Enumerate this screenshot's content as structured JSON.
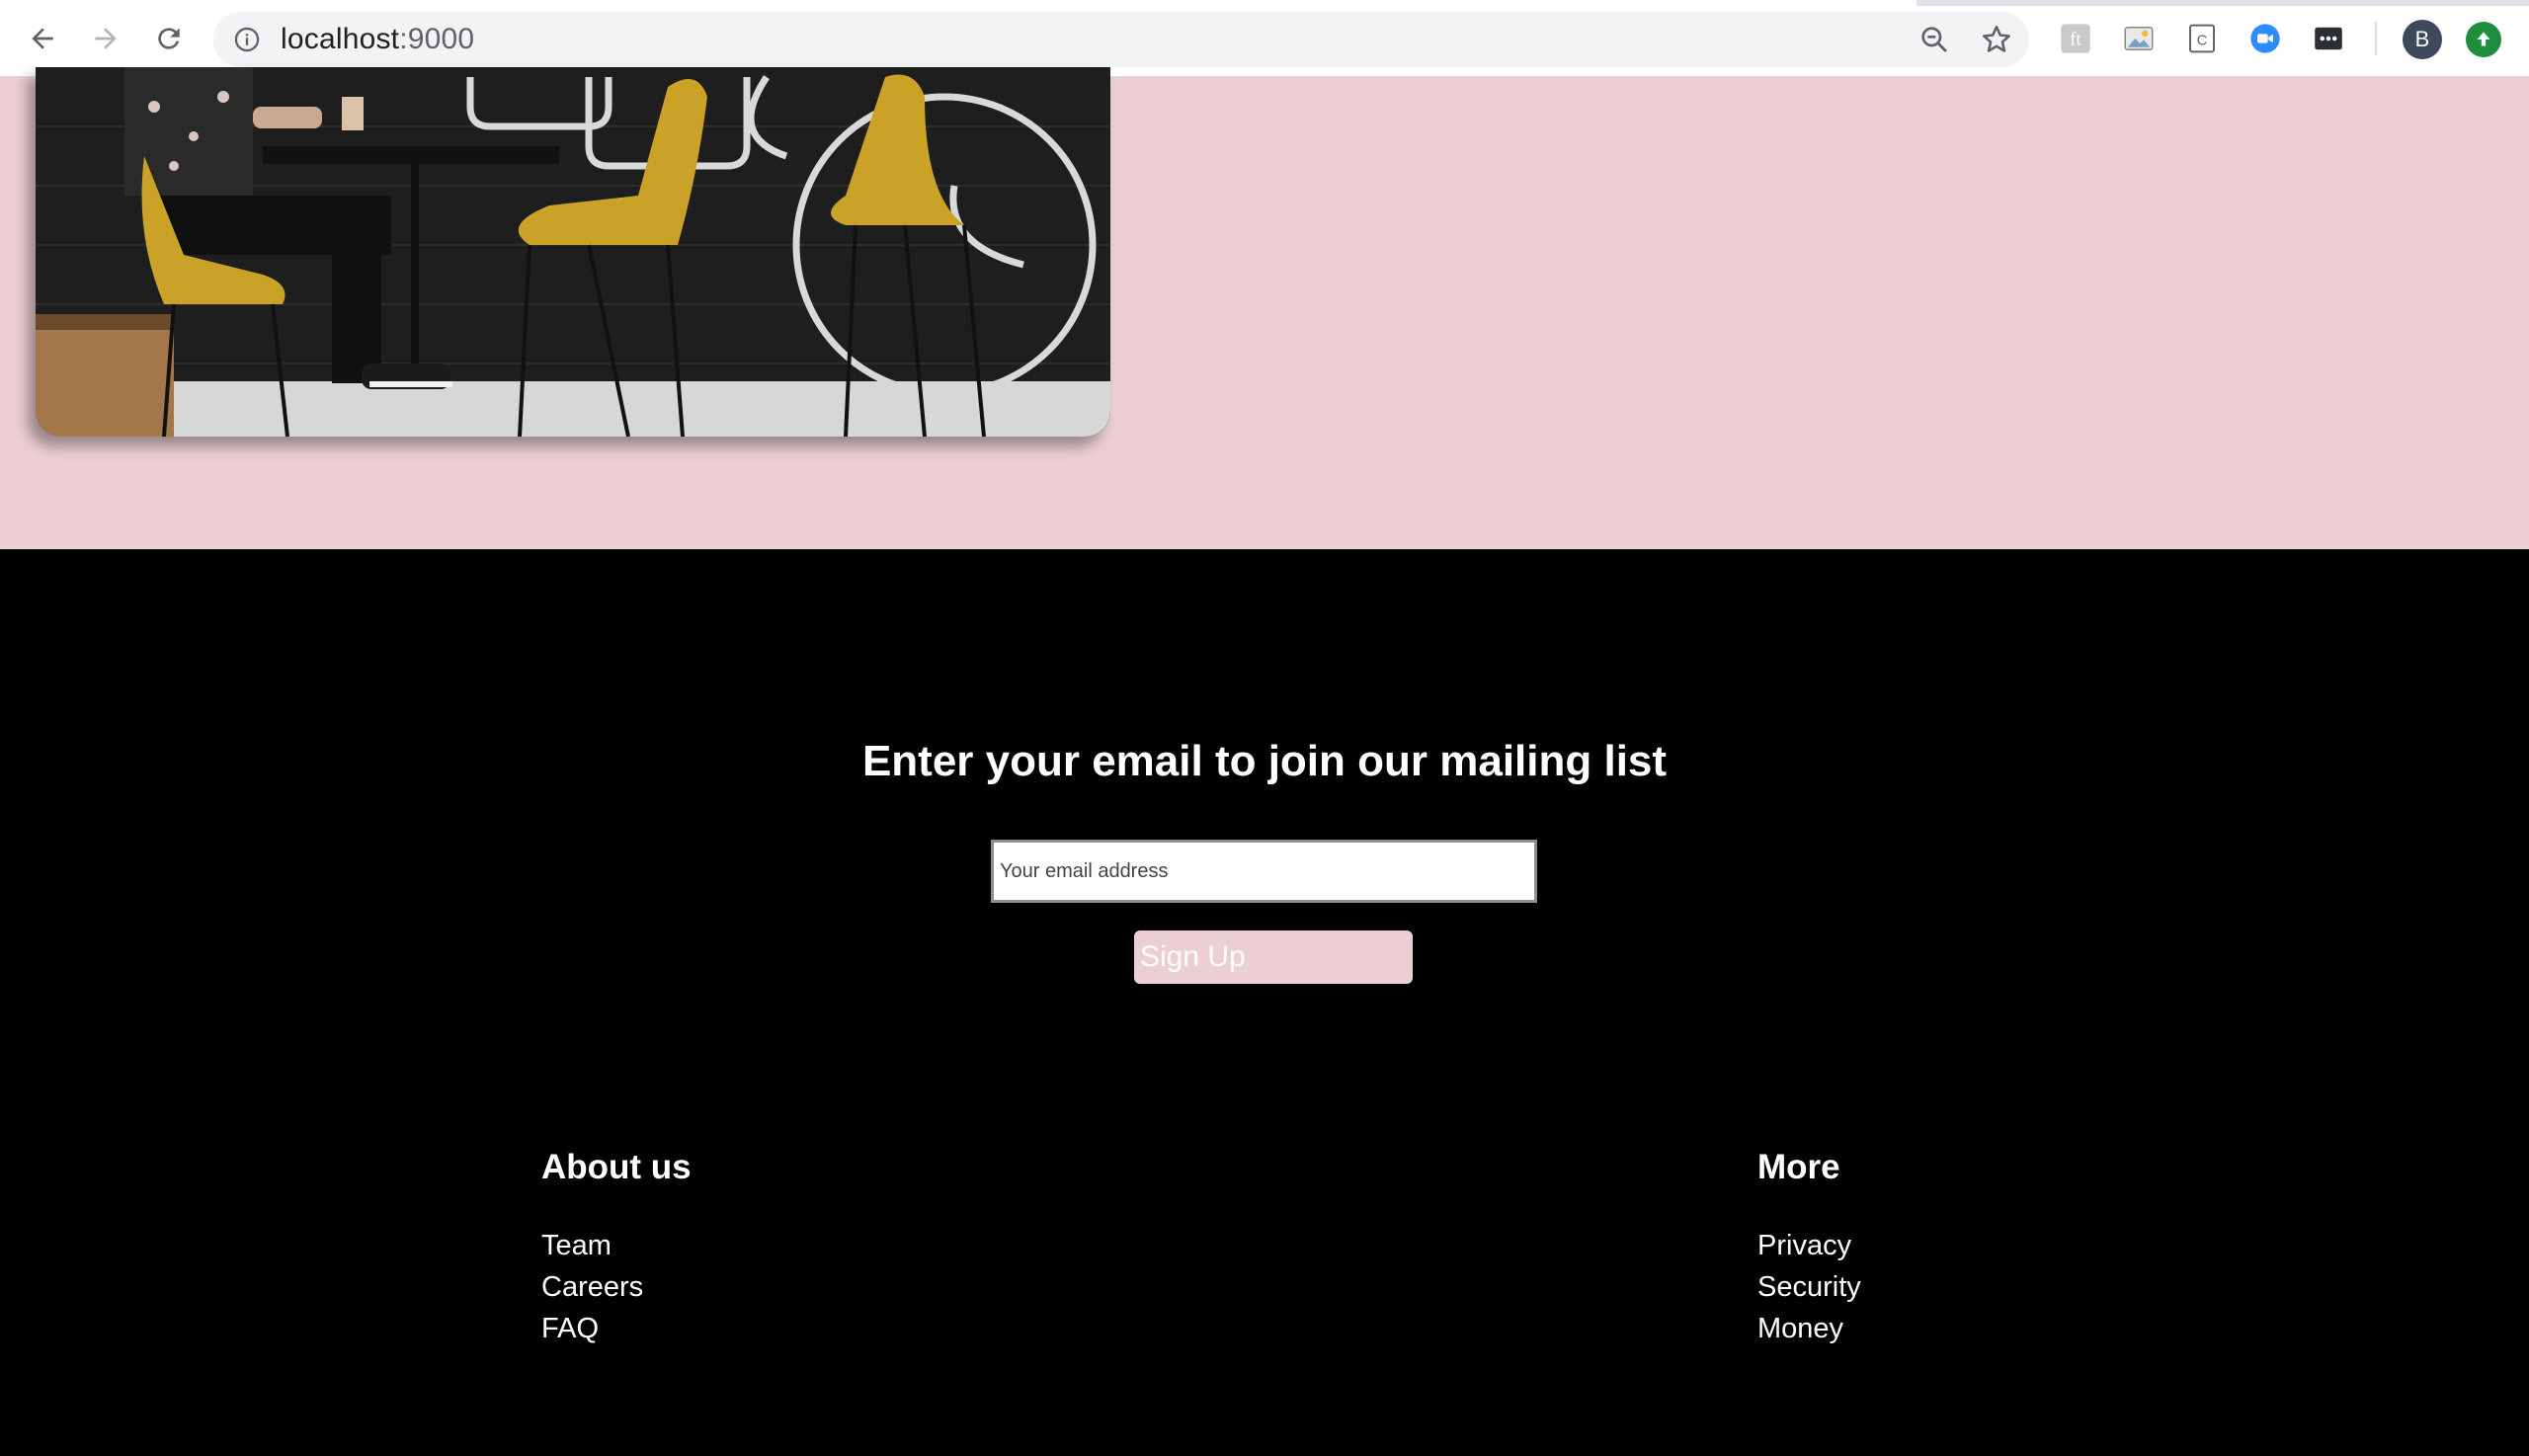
{
  "browser": {
    "url_host": "localhost",
    "url_port": ":9000",
    "profile_initial": "B",
    "extensions": [
      "font-extension-icon",
      "image-extension-icon",
      "clipboard-extension-icon",
      "zoom-video-icon",
      "more-dots-extension-icon"
    ]
  },
  "colors": {
    "hero_background": "#ebcfd2",
    "footer_background": "#000000",
    "signup_button": "#ebcfd2",
    "chair_yellow": "#c9a227"
  },
  "hero": {
    "image_alt": "Person working at a table with yellow chairs"
  },
  "mailing": {
    "title": "Enter your email to join our mailing list",
    "email_placeholder": "Your email address",
    "signup_label": "Sign Up"
  },
  "footer": {
    "about": {
      "heading": "About us",
      "links": [
        "Team",
        "Careers",
        "FAQ"
      ]
    },
    "more": {
      "heading": "More",
      "links": [
        "Privacy",
        "Security",
        "Money"
      ]
    }
  }
}
